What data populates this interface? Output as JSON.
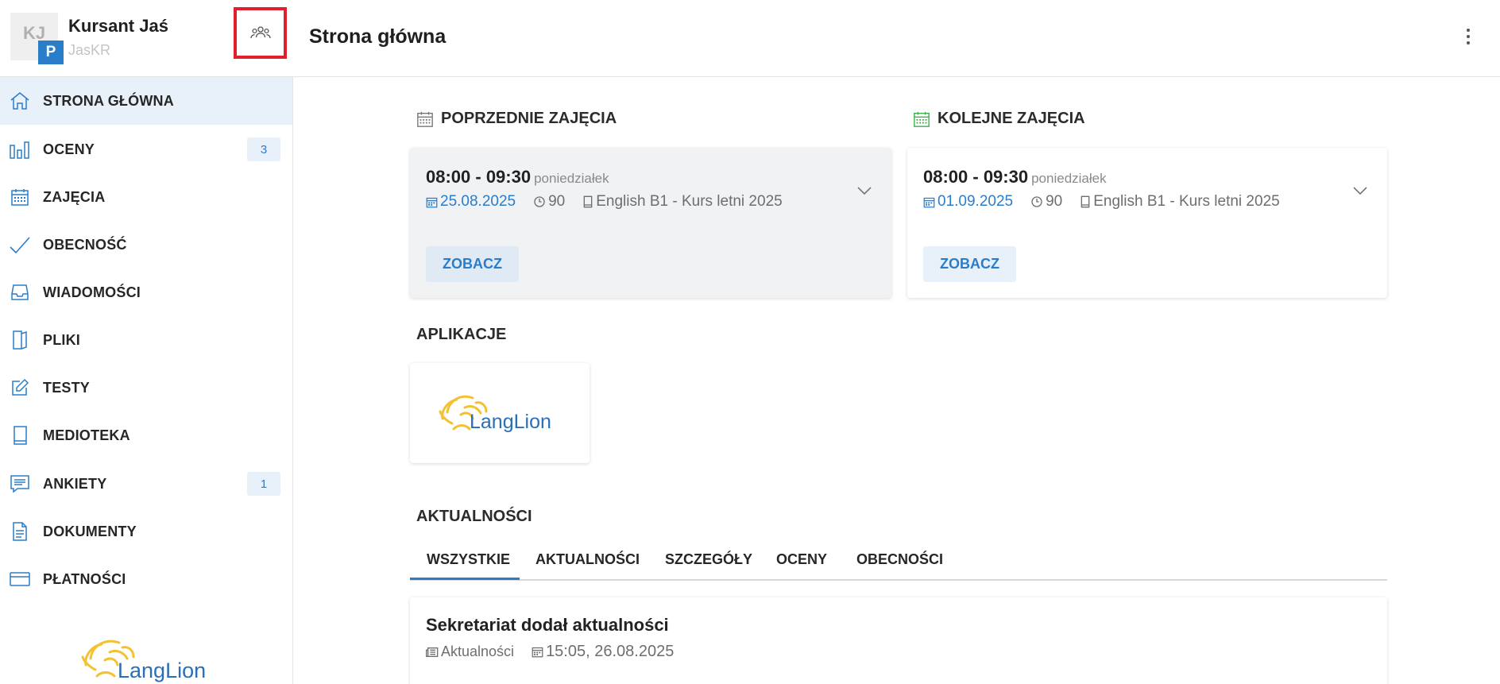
{
  "user": {
    "initials": "KJ",
    "badge": "P",
    "name": "Kursant Jaś",
    "login": "JasKR"
  },
  "header": {
    "title": "Strona główna"
  },
  "sidebar": {
    "items": [
      {
        "label": "STRONA GŁÓWNA",
        "icon": "home-icon",
        "active": true
      },
      {
        "label": "OCENY",
        "icon": "bar-chart-icon",
        "badge": "3"
      },
      {
        "label": "ZAJĘCIA",
        "icon": "calendar-icon"
      },
      {
        "label": "OBECNOŚĆ",
        "icon": "check-icon"
      },
      {
        "label": "WIADOMOŚCI",
        "icon": "inbox-icon"
      },
      {
        "label": "PLIKI",
        "icon": "files-icon"
      },
      {
        "label": "TESTY",
        "icon": "edit-icon"
      },
      {
        "label": "MEDIOTEKA",
        "icon": "book-icon"
      },
      {
        "label": "ANKIETY",
        "icon": "survey-icon",
        "badge": "1"
      },
      {
        "label": "DOKUMENTY",
        "icon": "document-icon"
      },
      {
        "label": "PŁATNOŚCI",
        "icon": "credit-card-icon"
      }
    ]
  },
  "logo": {
    "text_prefix": "Lang",
    "text_suffix": "Lion",
    "colors": {
      "lion": "#f2c230",
      "text": "#2a6fb5"
    }
  },
  "previous_lesson": {
    "heading": "POPRZEDNIE ZAJĘCIA",
    "time": "08:00 - 09:30",
    "day": "poniedziałek",
    "date": "25.08.2025",
    "duration": "90",
    "course": "English B1 - Kurs letni 2025",
    "button": "ZOBACZ"
  },
  "next_lesson": {
    "heading": "KOLEJNE ZAJĘCIA",
    "time": "08:00 - 09:30",
    "day": "poniedziałek",
    "date": "01.09.2025",
    "duration": "90",
    "course": "English B1 - Kurs letni 2025",
    "button": "ZOBACZ"
  },
  "apps": {
    "heading": "APLIKACJE"
  },
  "news": {
    "heading": "AKTUALNOŚCI",
    "tabs": [
      "WSZYSTKIE",
      "AKTUALNOŚCI",
      "SZCZEGÓŁY",
      "OCENY",
      "OBECNOŚCI"
    ],
    "active_tab": "WSZYSTKIE",
    "items": [
      {
        "title": "Sekretariat dodał aktualności",
        "category": "Aktualności",
        "datetime": "15:05, 26.08.2025"
      }
    ]
  },
  "colors": {
    "accent": "#2a7dc9",
    "active_bg": "#e8f1fa",
    "highlight_border": "#e0202a",
    "next_calendar_icon": "#3dae4a"
  }
}
